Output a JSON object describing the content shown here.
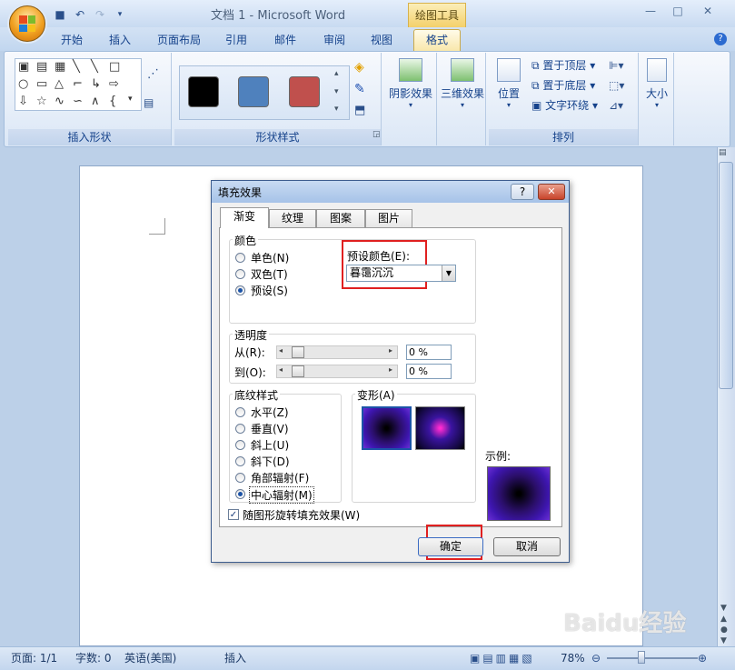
{
  "window": {
    "title": "文档 1 - Microsoft Word",
    "context_tool": "绘图工具"
  },
  "tabs": [
    "开始",
    "插入",
    "页面布局",
    "引用",
    "邮件",
    "审阅",
    "视图",
    "格式"
  ],
  "ribbon": {
    "group_insert_shapes": "插入形状",
    "group_shape_styles": "形状样式",
    "shadow_label": "阴影效果",
    "threed_label": "三维效果",
    "position_label": "位置",
    "bring_front": "置于顶层",
    "send_back": "置于底层",
    "text_wrap": "文字环绕",
    "group_arrange": "排列",
    "size_label": "大小",
    "swatches": [
      "#000000",
      "#4f81bd",
      "#c0504d"
    ]
  },
  "dialog": {
    "title": "填充效果",
    "help": "?",
    "close": "✕",
    "tabs": [
      "渐变",
      "纹理",
      "图案",
      "图片"
    ],
    "colors_title": "颜色",
    "color_options": [
      "单色(N)",
      "双色(T)",
      "预设(S)"
    ],
    "preset_label": "预设颜色(E):",
    "preset_value": "暮霭沉沉",
    "transparency_title": "透明度",
    "from_label": "从(R):",
    "to_label": "到(O):",
    "from_value": "0 %",
    "to_value": "0 %",
    "shading_title": "底纹样式",
    "shading_options": [
      "水平(Z)",
      "垂直(V)",
      "斜上(U)",
      "斜下(D)",
      "角部辐射(F)",
      "中心辐射(M)"
    ],
    "variants_title": "变形(A)",
    "sample_label": "示例:",
    "rotate_label": "随图形旋转填充效果(W)",
    "ok": "确定",
    "cancel": "取消",
    "gradient_colors": [
      "#000000",
      "#2b0f6a",
      "#3e16b0",
      "#6a2fd6"
    ]
  },
  "status": {
    "page": "页面: 1/1",
    "words": "字数: 0",
    "lang": "英语(美国)",
    "mode": "插入",
    "zoom": "78%"
  },
  "watermark": "Baidu经验"
}
